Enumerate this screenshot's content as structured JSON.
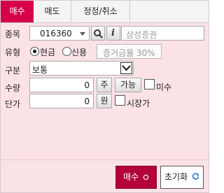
{
  "tabs": [
    {
      "label": "매수"
    },
    {
      "label": "매도"
    },
    {
      "label": "정정/취소"
    }
  ],
  "form": {
    "stock_label": "종목",
    "stock_code": "016360",
    "stock_name_placeholder": "삼성증권",
    "type_label": "유형",
    "type_cash": "현금",
    "type_credit": "신용",
    "margin_rate": "증거금율 30%",
    "category_label": "구분",
    "category_value": "보통",
    "qty_label": "수량",
    "qty_value": "0",
    "qty_unit": "주",
    "qty_possible": "가능",
    "qty_unsettled": "미수",
    "price_label": "단가",
    "price_value": "0",
    "price_unit": "원",
    "market_price": "시장가"
  },
  "actions": {
    "buy": "매수",
    "reset": "초기화"
  }
}
